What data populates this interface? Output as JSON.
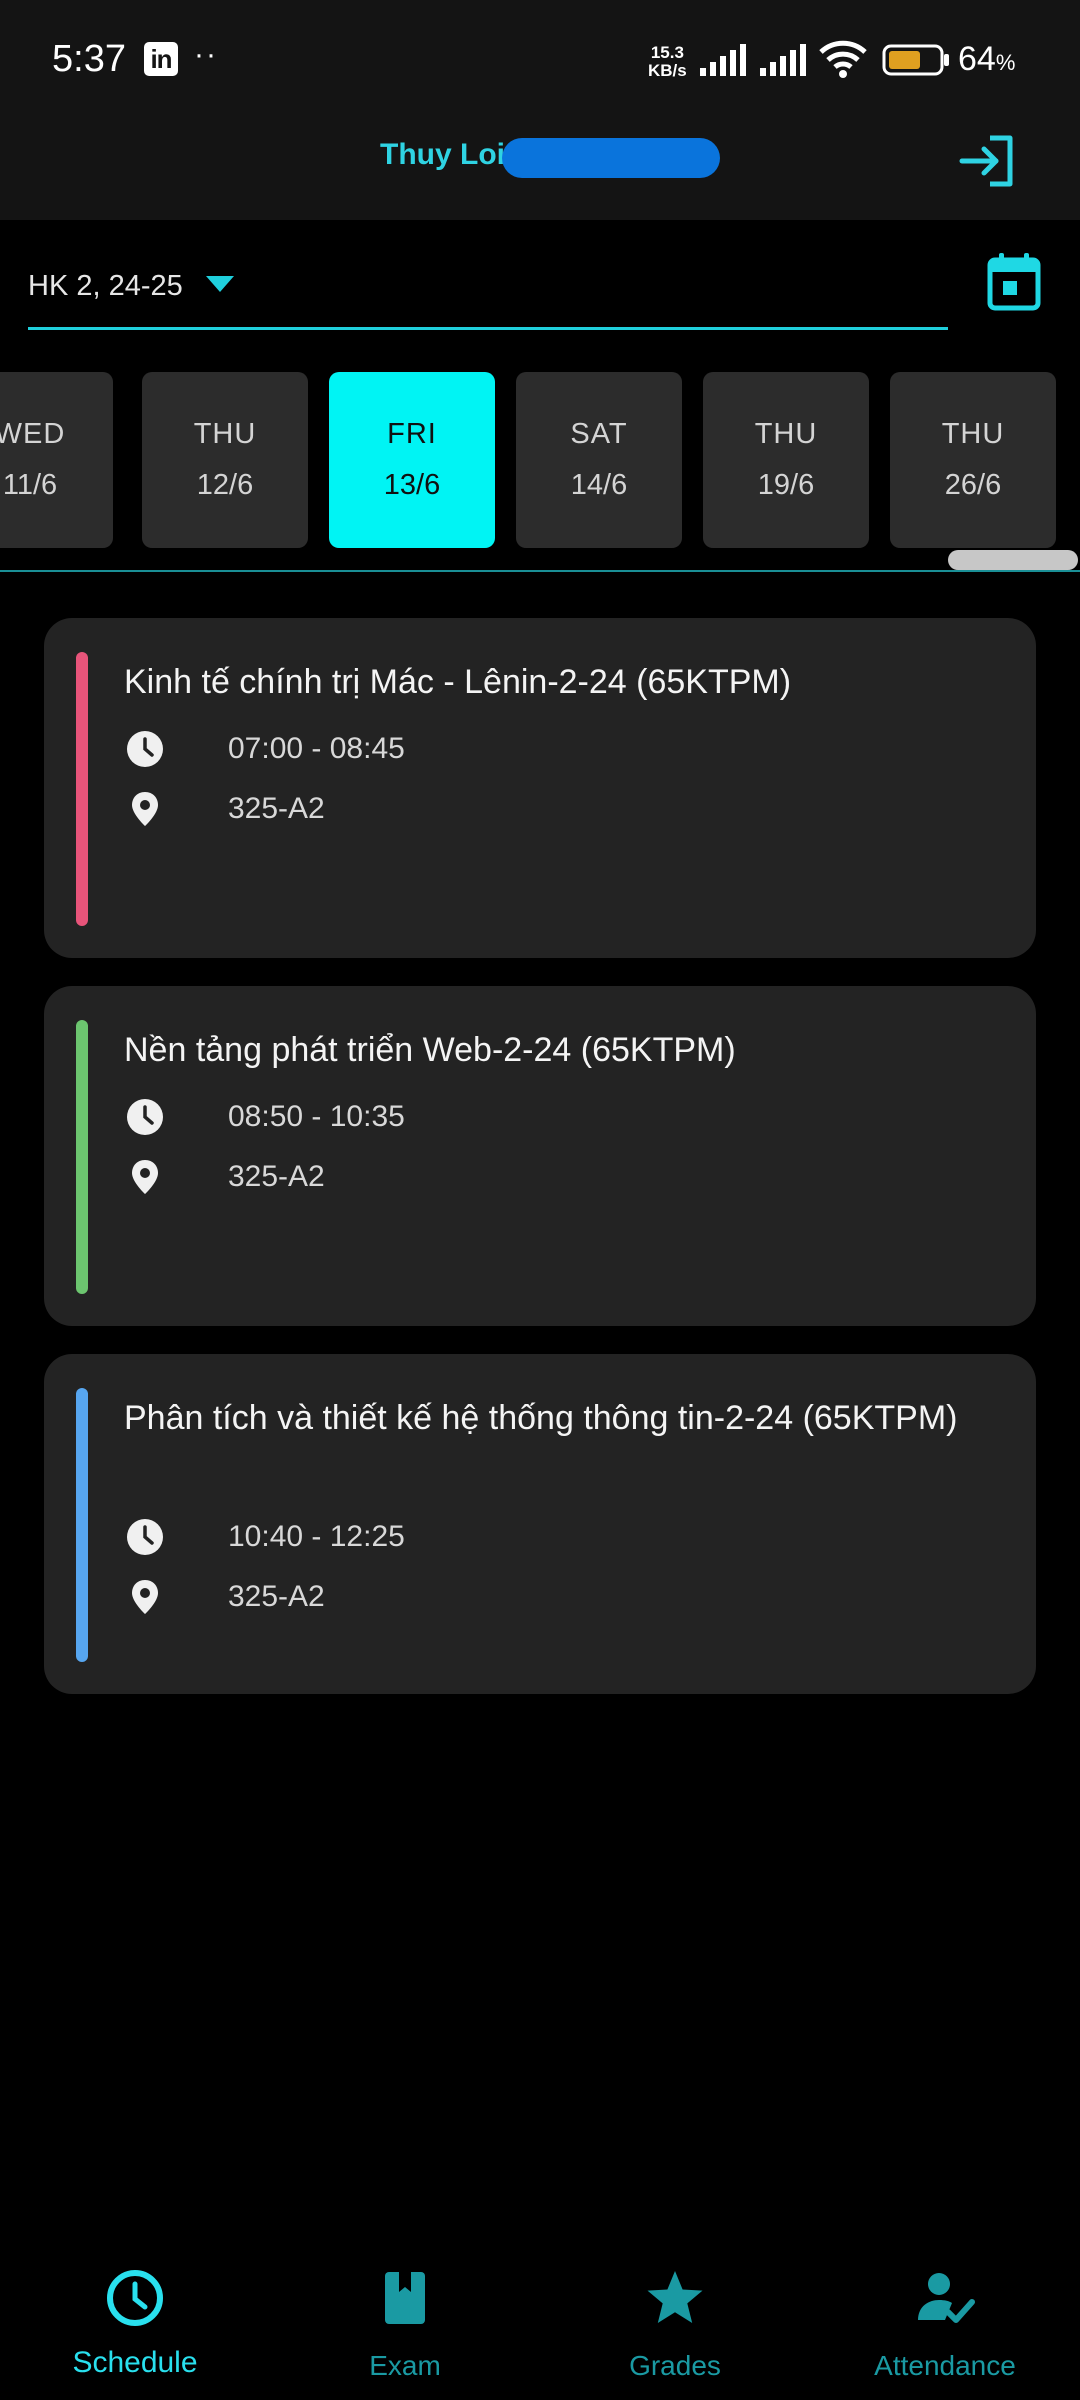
{
  "status_bar": {
    "time": "5:37",
    "linkedin_icon": "linkedin-icon",
    "dots": "··",
    "speed_value": "15.3",
    "speed_unit": "KB/s",
    "battery_value": "64",
    "battery_unit": "%",
    "battery_level": 0.64,
    "battery_color": "#e0a020"
  },
  "header": {
    "title": "Thuy Loi",
    "logout_icon": "logout-icon",
    "accent": "#2fd3e3"
  },
  "semester": {
    "selected": "HK 2, 24-25",
    "dropdown_icon": "caret-down-icon",
    "calendar_icon": "calendar-icon"
  },
  "days": [
    {
      "dow": "WED",
      "date": "11/6",
      "active": false
    },
    {
      "dow": "THU",
      "date": "12/6",
      "active": false
    },
    {
      "dow": "FRI",
      "date": "13/6",
      "active": true
    },
    {
      "dow": "SAT",
      "date": "14/6",
      "active": false
    },
    {
      "dow": "THU",
      "date": "19/6",
      "active": false
    },
    {
      "dow": "THU",
      "date": "26/6",
      "active": false
    }
  ],
  "classes": [
    {
      "title": "Kinh tế chính trị Mác - Lênin-2-24 (65KTPM)",
      "time": "07:00 - 08:45",
      "room": "325-A2",
      "color": "#e8547a"
    },
    {
      "title": "Nền tảng phát triển Web-2-24 (65KTPM)",
      "time": "08:50 - 10:35",
      "room": "325-A2",
      "color": "#6cc56f"
    },
    {
      "title": "Phân tích và thiết kế hệ thống thông tin-2-24 (65KTPM)",
      "time": "10:40 - 12:25",
      "room": "325-A2",
      "color": "#57a6f0"
    }
  ],
  "bottom_nav": [
    {
      "label": "Schedule",
      "icon": "clock-icon",
      "active": true
    },
    {
      "label": "Exam",
      "icon": "book-icon",
      "active": false
    },
    {
      "label": "Grades",
      "icon": "star-icon",
      "active": false
    },
    {
      "label": "Attendance",
      "icon": "person-check-icon",
      "active": false
    }
  ]
}
